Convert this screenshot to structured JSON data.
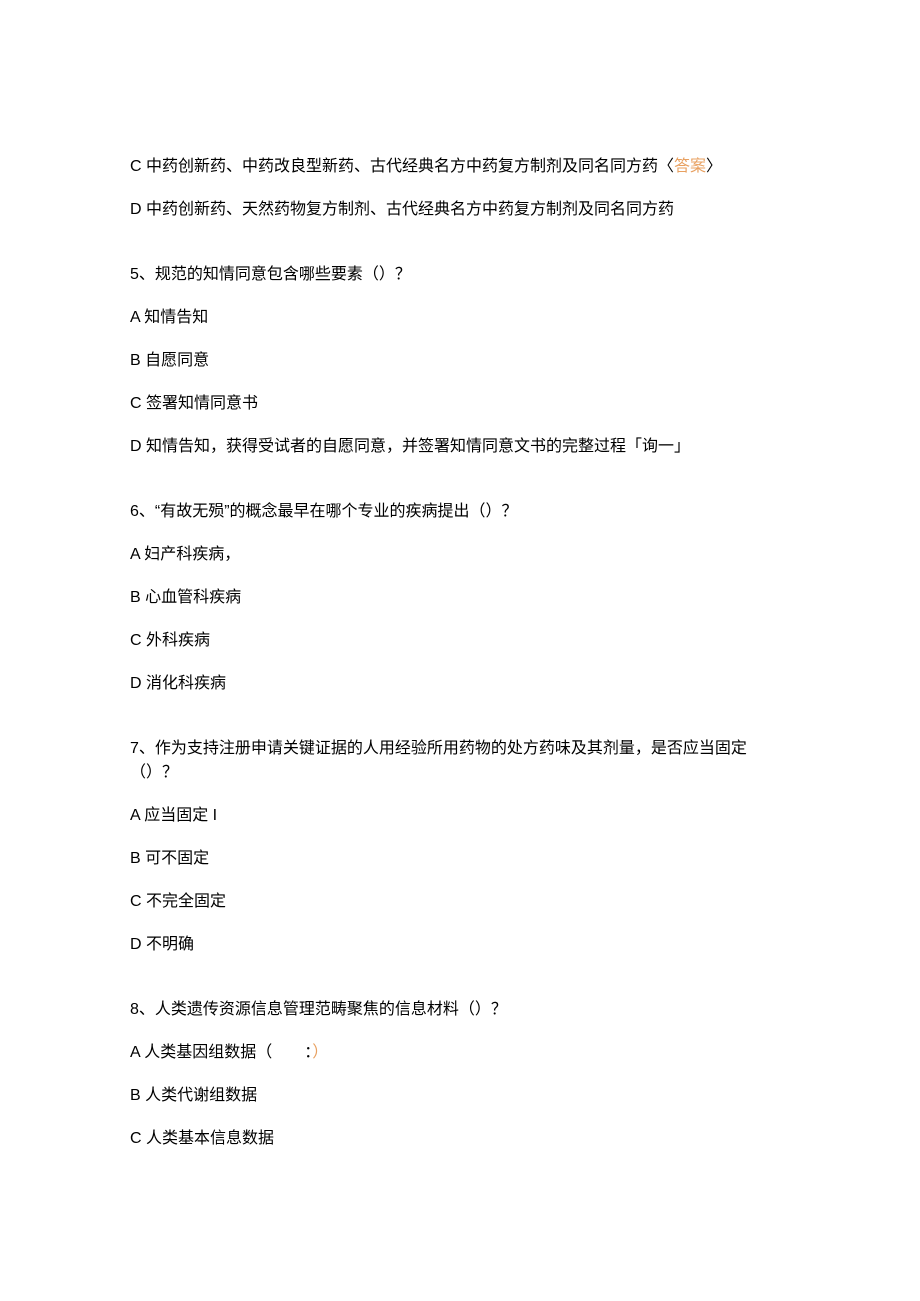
{
  "q4": {
    "c_prefix": "C 中药创新药、中药改良型新药、古代经典名方中药复方制剂及同名同方药〈",
    "c_answer": "答案",
    "c_suffix": "〉",
    "d": "D 中药创新药、天然药物复方制剂、古代经典名方中药复方制剂及同名同方药"
  },
  "q5": {
    "stem": "5、规范的知情同意包含哪些要素（）？",
    "a": "A 知情告知",
    "b": "B 自愿同意",
    "c": "C 签署知情同意书",
    "d": "D 知情告知，获得受试者的自愿同意，并签署知情同意文书的完整过程「询一」"
  },
  "q6": {
    "stem": "6、“有故无殒”的概念最早在哪个专业的疾病提出（）？",
    "a": "A 妇产科疾病，",
    "b": "B 心血管科疾病",
    "c": "C 外科疾病",
    "d": "D 消化科疾病"
  },
  "q7": {
    "stem": "7、作为支持注册申请关键证据的人用经验所用药物的处方药味及其剂量，是否应当固定（）？",
    "a": "A 应当固定 I",
    "b": "B 可不固定",
    "c": "C 不完全固定",
    "d": "D 不明确"
  },
  "q8": {
    "stem": "8、人类遗传资源信息管理范畴聚焦的信息材料（）？",
    "a_prefix": "A 人类基因组数据（  ：",
    "a_paren": "）",
    "b": "B 人类代谢组数据",
    "c": "C 人类基本信息数据"
  }
}
